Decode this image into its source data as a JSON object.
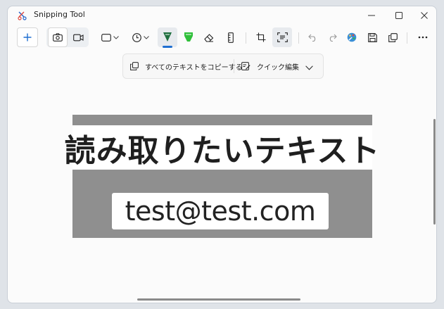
{
  "window": {
    "title": "Snipping Tool"
  },
  "icons": {
    "app": "snipping-tool-icon",
    "minimize": "minimize-icon",
    "maximize": "maximize-icon",
    "close": "close-icon",
    "new": "plus-icon",
    "screenshot_mode": "camera-icon",
    "video_mode": "video-camera-icon",
    "shape": "rectangle-shape-icon",
    "delay": "clock-icon",
    "ballpoint_pen": "ballpoint-pen-icon",
    "highlighter": "highlighter-icon",
    "eraser": "eraser-icon",
    "ruler": "ruler-icon",
    "crop": "crop-icon",
    "text_actions": "text-actions-icon",
    "undo": "undo-icon",
    "redo": "redo-icon",
    "paint": "paint-icon",
    "save": "save-icon",
    "copy": "copy-icon",
    "more": "more-icon"
  },
  "colors": {
    "accent": "#1f6fd1",
    "ballpoint_pen": "#1f6f3f",
    "highlighter": "#2fbf3a"
  },
  "text_actions": {
    "copy_all_label": "すべてのテキストをコピーする",
    "quick_redact_label": "クイック編集"
  },
  "capture": {
    "heading": "読み取りたいテキスト",
    "email": "test@test.com"
  }
}
